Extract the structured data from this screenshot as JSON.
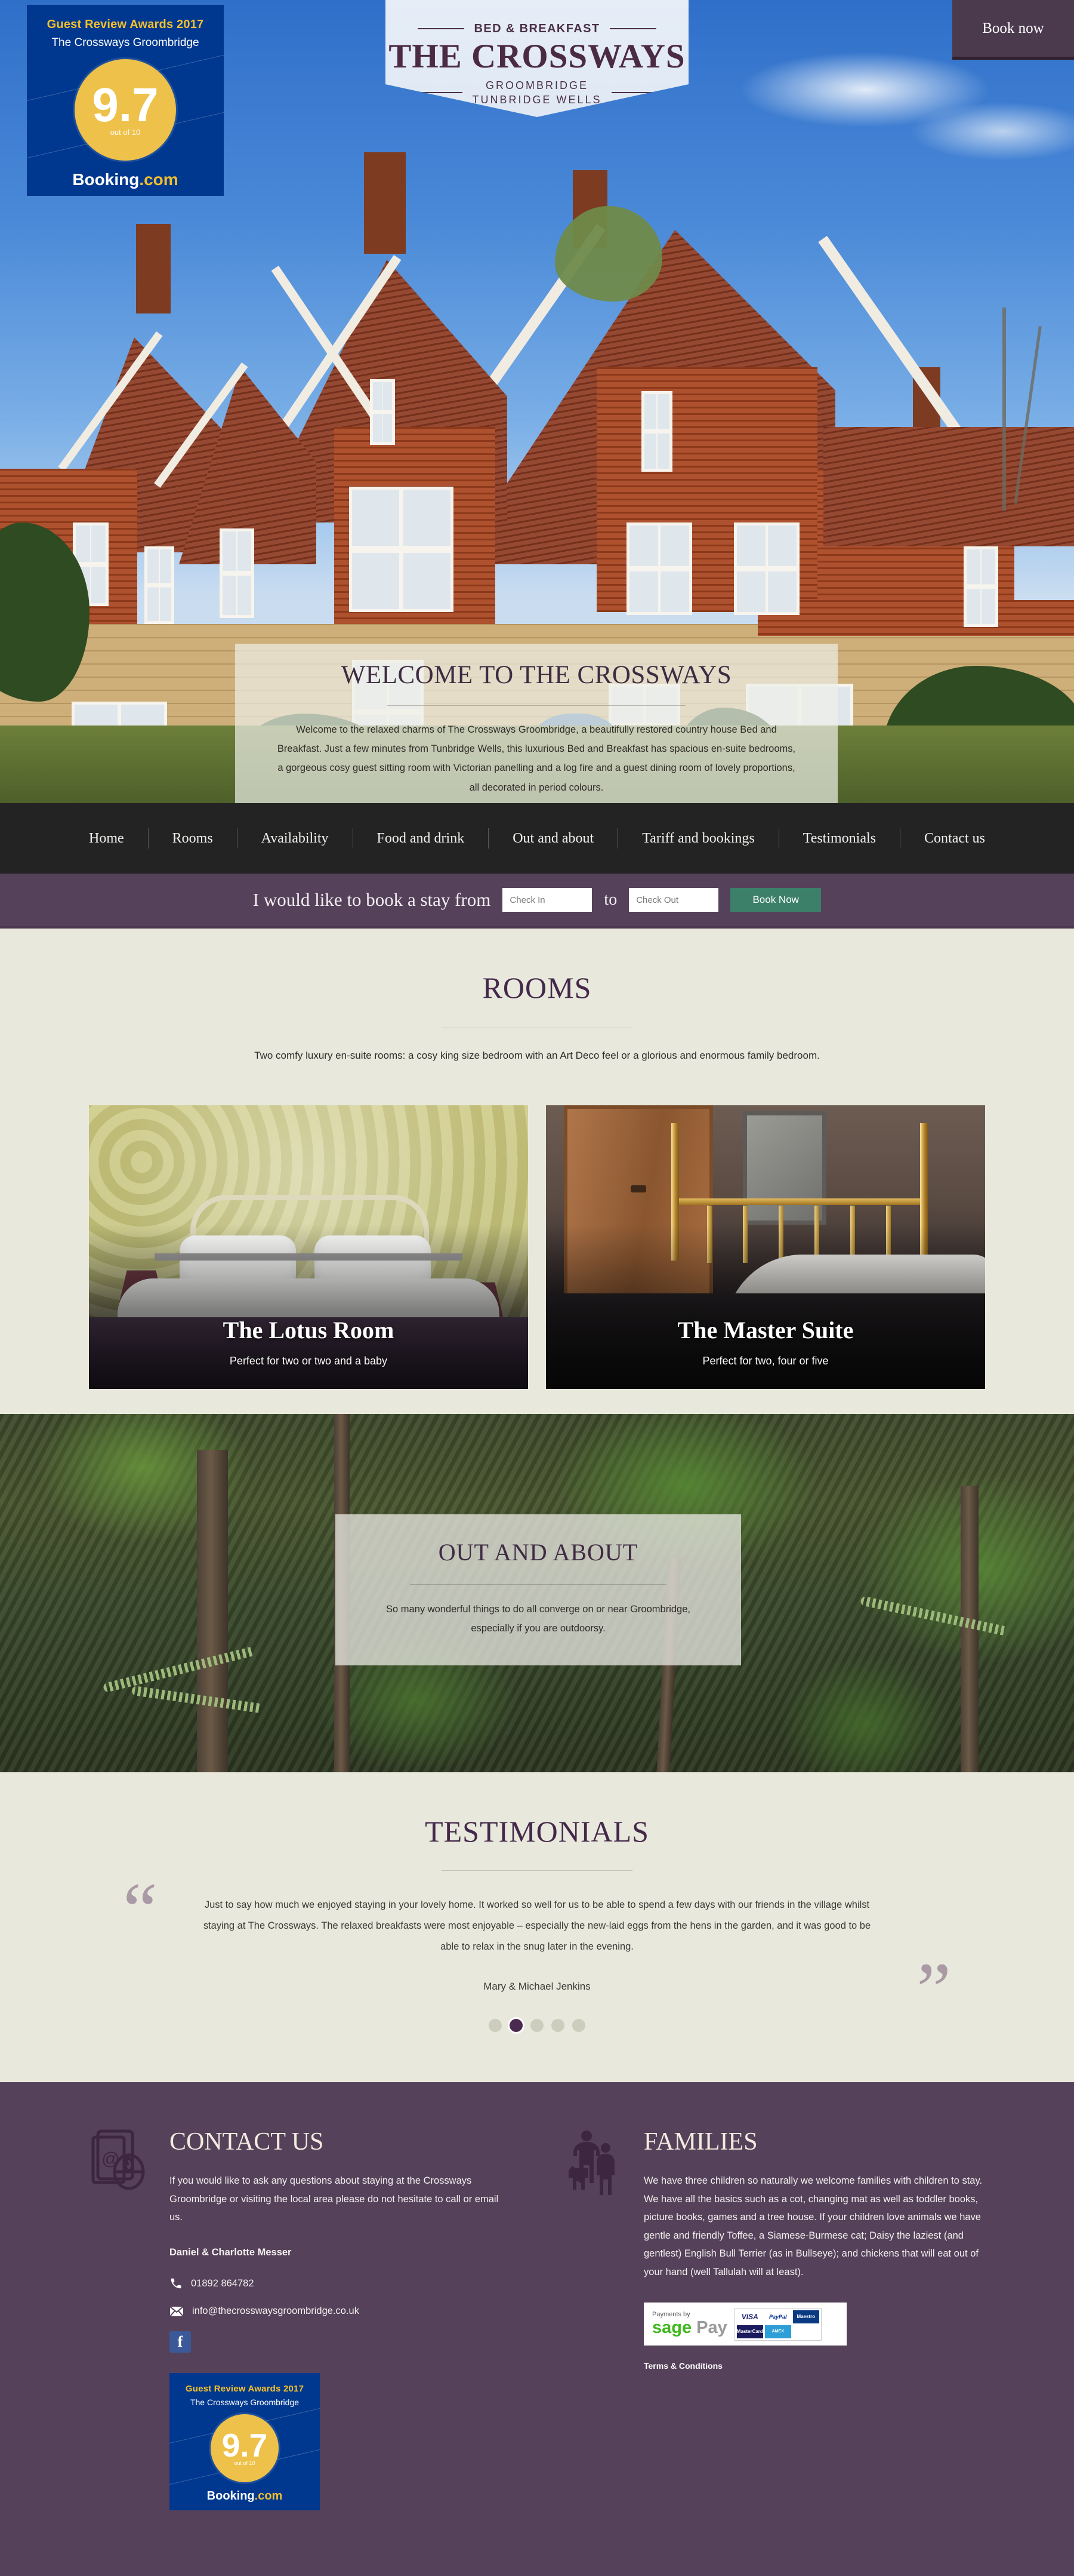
{
  "brand": {
    "kicker": "BED & BREAKFAST",
    "name": "THE CROSSWAYS",
    "location_line1": "GROOMBRIDGE",
    "location_line2": "TUNBRIDGE WELLS"
  },
  "colors": {
    "plum": "#55415a",
    "plum_dark": "#4b3a4e",
    "heading_purple": "#44284a",
    "cream": "#e8e9dc",
    "nav_dark": "#232323",
    "book_green": "#3c8069",
    "booking_blue": "#00388f",
    "booking_gold": "#eec14a",
    "facebook_blue": "#3b5998"
  },
  "hero": {
    "book_now_label": "Book now",
    "booking_badge": {
      "awards": "Guest Review Awards 2017",
      "property": "The Crossways Groombridge",
      "score": "9.7",
      "out_of": "out of 10",
      "brand_prefix": "Booking",
      "brand_suffix": ".com"
    }
  },
  "welcome": {
    "title": "WELCOME TO THE CROSSWAYS",
    "body": "Welcome to the relaxed charms of The Crossways Groombridge, a beautifully restored country house Bed and Breakfast. Just a few minutes from Tunbridge Wells, this luxurious Bed and Breakfast has spacious en-suite bedrooms, a gorgeous cosy guest sitting room with Victorian panelling and a log fire and a guest dining room of lovely proportions, all decorated in period colours."
  },
  "nav": {
    "items": [
      {
        "label": "Home"
      },
      {
        "label": "Rooms"
      },
      {
        "label": "Availability"
      },
      {
        "label": "Food and drink"
      },
      {
        "label": "Out and about"
      },
      {
        "label": "Tariff and bookings"
      },
      {
        "label": "Testimonials"
      },
      {
        "label": "Contact us"
      }
    ]
  },
  "bookbar": {
    "lead": "I would like to book a stay from",
    "checkin_placeholder": "Check In",
    "checkin_value": "",
    "to": "to",
    "checkout_placeholder": "Check Out",
    "checkout_value": "",
    "submit_label": "Book Now"
  },
  "rooms": {
    "title": "ROOMS",
    "blurb": "Two comfy luxury en-suite rooms: a cosy king size bedroom with an Art Deco feel or a glorious and enormous family bedroom.",
    "cards": [
      {
        "name": "The Lotus Room",
        "tagline": "Perfect for two or two and a baby"
      },
      {
        "name": "The Master Suite",
        "tagline": "Perfect for two, four or five"
      }
    ]
  },
  "out_and_about": {
    "title": "OUT AND ABOUT",
    "body": "So many wonderful things to do all converge on or near Groombridge, especially if you are outdoorsy."
  },
  "testimonials": {
    "title": "TESTIMONIALS",
    "quote": "Just to say how much we enjoyed staying in your lovely home. It worked so well for us to be able to spend a few days with our friends in the village whilst staying at The Crossways. The relaxed breakfasts were most enjoyable – especially the new-laid eggs from the hens in the garden, and it was good to be able to relax in the snug later in the evening.",
    "author": "Mary & Michael Jenkins",
    "open_quote_glyph": "“",
    "close_quote_glyph": "”",
    "dot_count": 5,
    "active_dot": 2
  },
  "footer": {
    "contact": {
      "title": "CONTACT US",
      "body": "If you would like to ask any questions about staying at the Crossways Groombridge or visiting the local area please do not hesitate to call or email us.",
      "names": "Daniel & Charlotte Messer",
      "phone": "01892 864782",
      "email": "info@thecrosswaysgroombridge.co.uk",
      "facebook_glyph": "f",
      "booking_badge": {
        "awards": "Guest Review Awards 2017",
        "property": "The Crossways Groombridge",
        "score": "9.7",
        "out_of": "out of 10",
        "brand_prefix": "Booking",
        "brand_suffix": ".com"
      }
    },
    "families": {
      "title": "FAMILIES",
      "body": "We have three children so naturally we welcome families with children to stay. We have all the basics such as a cot, changing mat as well as toddler books, picture books, games and a tree house. If your children love animals we have gentle and friendly Toffee, a Siamese-Burmese cat; Daisy the laziest (and gentlest) English Bull Terrier (as in Bullseye); and chickens that will eat out of your hand (well Tallulah will at least).",
      "payments": {
        "label": "Payments by",
        "logo_sage": "sage",
        "logo_pay": "Pay",
        "cards": [
          "VISA",
          "PayPal",
          "Maestro",
          "MasterCard",
          "AMEX"
        ]
      },
      "terms_label": "Terms & Conditions"
    }
  }
}
